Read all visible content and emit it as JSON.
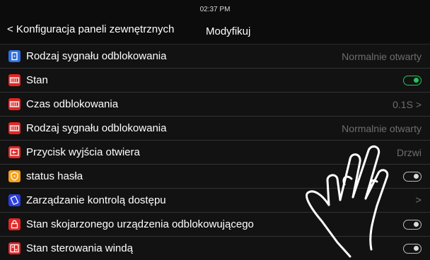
{
  "status_bar": {
    "time": "02:37 PM"
  },
  "header": {
    "back_label": "< Konfiguracja paneli zewnętrznych",
    "title": "Modyfikuj"
  },
  "rows": [
    {
      "label": "Rodzaj sygnału odblokowania",
      "value": "Normalnie otwarty",
      "icon": "signal-type-icon",
      "icon_color": "#2f6fe0"
    },
    {
      "label": "Stan",
      "control": "toggle-on",
      "icon": "door-panel-icon",
      "icon_color": "#e32626"
    },
    {
      "label": "Czas odblokowania",
      "value": "0.1S",
      "chevron": ">",
      "icon": "door-panel-icon",
      "icon_color": "#e32626"
    },
    {
      "label": "Rodzaj sygnału odblokowania",
      "value": "Normalnie otwarty",
      "icon": "door-panel-icon",
      "icon_color": "#e32626"
    },
    {
      "label": "Przycisk wyjścia otwiera",
      "value": "Drzwi",
      "icon": "exit-button-icon",
      "icon_color": "#e32626"
    },
    {
      "label": "status hasła",
      "control": "toggle-off",
      "icon": "shield-icon",
      "icon_color": "#f59f1a"
    },
    {
      "label": "Zarządzanie kontrolą dostępu",
      "chevron": ">",
      "icon": "card-icon",
      "icon_color": "#2b3fe0"
    },
    {
      "label": "Stan skojarzonego urządzenia odblokowującego",
      "control": "toggle-off",
      "icon": "lock-icon",
      "icon_color": "#e32626"
    },
    {
      "label": "Stan sterowania windą",
      "control": "toggle-off",
      "icon": "elevator-icon",
      "icon_color": "#e32626"
    }
  ]
}
